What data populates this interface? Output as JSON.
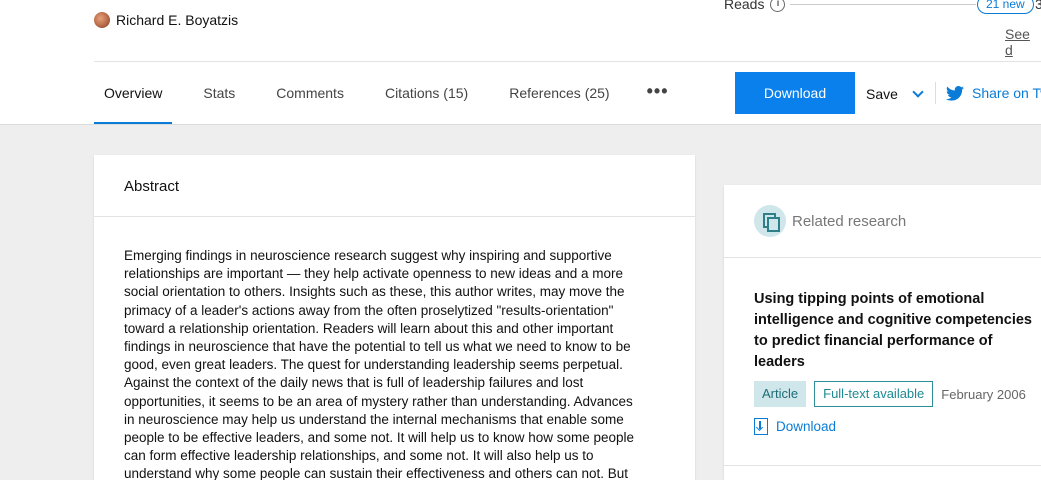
{
  "header": {
    "author_name": "Richard E. Boyatzis",
    "reads_label": "Reads",
    "reads_new_badge": "21 new",
    "reads_count_partial": "3",
    "see_link_partial": "See d"
  },
  "tabs": [
    {
      "label": "Overview",
      "active": true
    },
    {
      "label": "Stats"
    },
    {
      "label": "Comments"
    },
    {
      "label": "Citations (15)"
    },
    {
      "label": "References (25)"
    }
  ],
  "more_label": "•••",
  "actions": {
    "download_label": "Download",
    "save_label": "Save",
    "share_label": "Share on Tw"
  },
  "abstract": {
    "title": "Abstract",
    "lines": [
      "Emerging findings in neuroscience research suggest why inspiring and supportive",
      "relationships are important — they help activate openness to new ideas and a more",
      "social orientation to others. Insights such as these, this author writes, may move the",
      "primacy of a leader's actions away from the often proselytized \"results-orientation\"",
      "toward a relationship orientation. Readers will learn about this and other important",
      "findings in neuroscience that have the potential to tell us what we need to know to be",
      "good, even great leaders. The quest for understanding leadership seems perpetual.",
      "Against the context of the daily news that is full of leadership failures and lost",
      "opportunities, it seems to be an area of mystery rather than understanding. Advances",
      "in neuroscience may help us understand the internal mechanisms that enable some",
      "people to be effective leaders, and some not. It will help us to know how some people",
      "can form effective leadership relationships, and some not. It will also help us to",
      "understand why some people can sustain their effectiveness and others can not. But"
    ]
  },
  "related": {
    "header_label": "Related research",
    "item": {
      "title_lines": [
        "Using tipping points of emotional",
        "intelligence and cognitive competencies",
        "to predict financial performance of",
        "leaders"
      ],
      "type_tag": "Article",
      "availability_tag": "Full-text available",
      "date": "February 2006",
      "download_label": "Download"
    }
  },
  "colors": {
    "accent_blue": "#0a80ec",
    "teal": "#2e7f88",
    "background_gray": "#eeeeee"
  }
}
